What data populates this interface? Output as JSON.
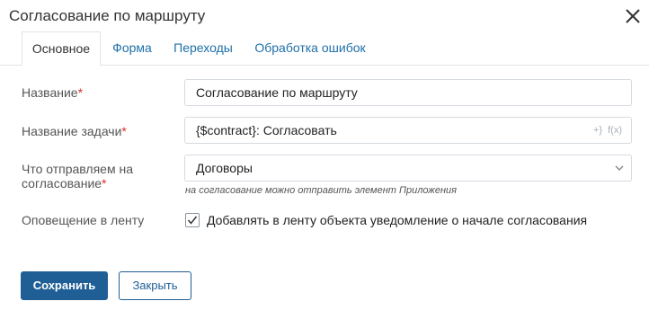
{
  "dialog": {
    "title": "Согласование по маршруту"
  },
  "tabs": [
    {
      "label": "Основное",
      "active": true
    },
    {
      "label": "Форма",
      "active": false
    },
    {
      "label": "Переходы",
      "active": false
    },
    {
      "label": "Обработка ошибок",
      "active": false
    }
  ],
  "form": {
    "name": {
      "label": "Название",
      "required_mark": "*",
      "value": "Согласование по маршруту"
    },
    "task_name": {
      "label": "Название задачи",
      "required_mark": "*",
      "value": "{$contract}: Согласовать",
      "icon_vars": "+}",
      "icon_fx": "f(x)"
    },
    "what_to_send": {
      "label_line1": "Что отправляем на",
      "label_line2": "согласование",
      "required_mark": "*",
      "selected": "Договоры",
      "hint": "на согласование можно отправить элемент Приложения"
    },
    "feed_notify": {
      "label": "Оповещение в ленту",
      "checkbox_label": "Добавлять в ленту объекта уведомление о начале согласования",
      "checked": true
    }
  },
  "buttons": {
    "save": "Сохранить",
    "close": "Закрыть"
  },
  "colors": {
    "accent": "#1e6fa8",
    "primary_button": "#1f5f95",
    "required": "#d9302c",
    "border": "#d6dbe1"
  },
  "icons": {
    "close": "close-icon",
    "dropdown": "chevron-down-icon",
    "checkbox": "check-icon",
    "variables": "variables-icon",
    "function": "function-icon"
  }
}
